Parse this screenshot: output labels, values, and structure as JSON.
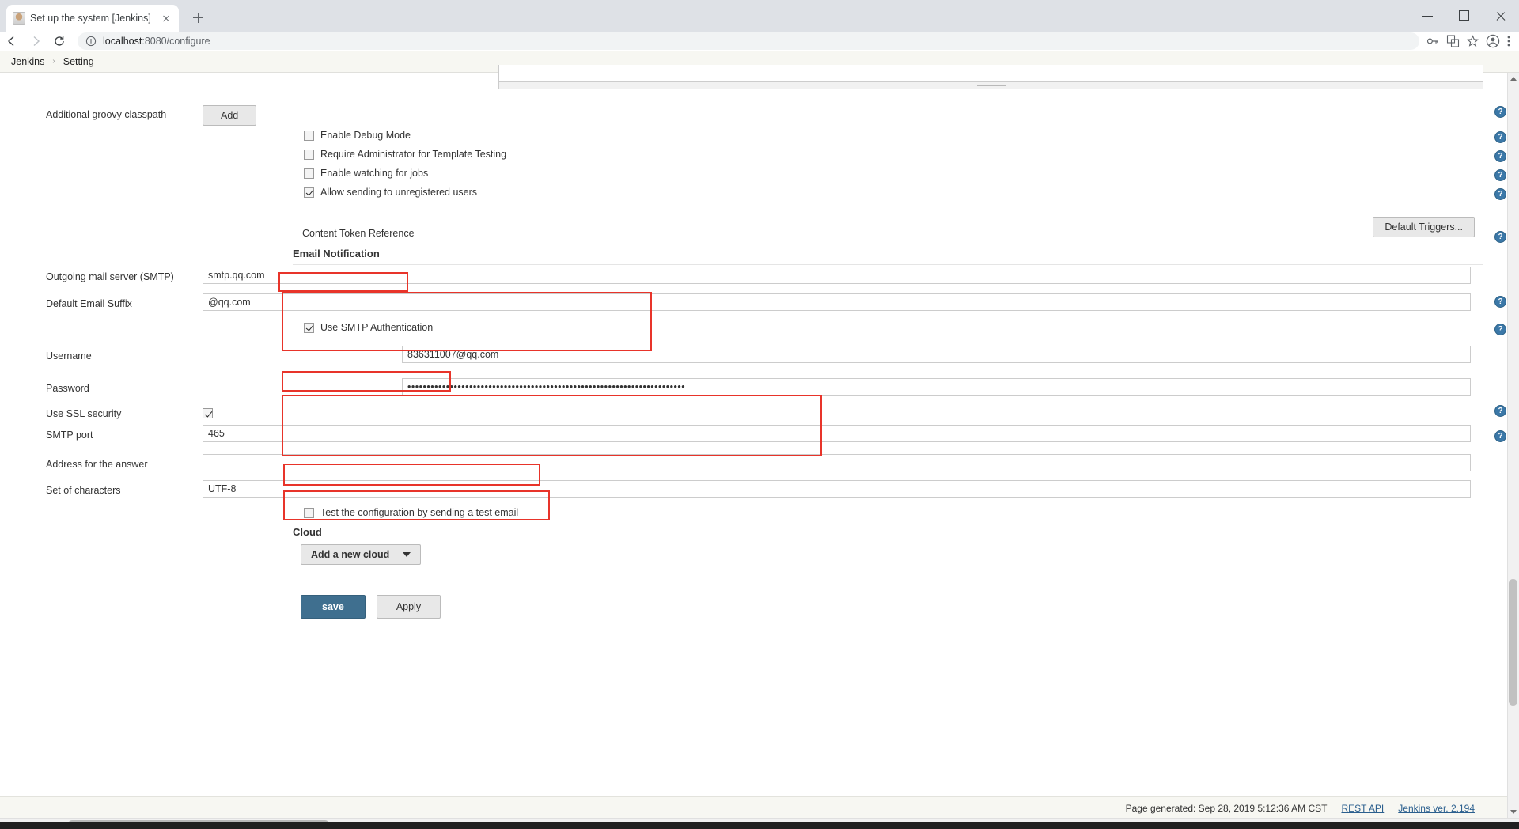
{
  "browser": {
    "tab_title": "Set up the system [Jenkins]",
    "favicon_name": "jenkins-favicon",
    "new_tab_label": "+",
    "url_host": "localhost",
    "url_rest": ":8080/configure",
    "url_full": "localhost:8080/configure",
    "window_minimize": "minimize",
    "window_maximize": "maximize",
    "window_close": "close"
  },
  "breadcrumb": {
    "items": [
      "Jenkins",
      "Setting"
    ],
    "separator": "›"
  },
  "form": {
    "groovy_classpath_label": "Additional groovy classpath",
    "add_button": "Add",
    "checkboxes": [
      {
        "label": "Enable Debug Mode",
        "checked": false
      },
      {
        "label": "Require Administrator for Template Testing",
        "checked": false
      },
      {
        "label": "Enable watching for jobs",
        "checked": false
      },
      {
        "label": "Allow sending to unregistered users",
        "checked": true
      }
    ],
    "default_triggers_button": "Default Triggers...",
    "content_token_reference": "Content Token Reference"
  },
  "email_notification": {
    "section_title": "Email Notification",
    "smtp_server_label": "Outgoing mail server (SMTP)",
    "smtp_server_value": "smtp.qq.com",
    "default_suffix_label": "Default Email Suffix",
    "default_suffix_value": "@qq.com",
    "use_smtp_auth_label": "Use SMTP Authentication",
    "use_smtp_auth_checked": true,
    "username_label": "Username",
    "username_value": "836311007@qq.com",
    "password_label": "Password",
    "password_value": "••••••••••••••••••••••••••••••••••••••••••••••••••••••••••••••••••••••••",
    "use_ssl_label": "Use SSL security",
    "use_ssl_checked": true,
    "smtp_port_label": "SMTP port",
    "smtp_port_value": "465",
    "reply_address_label": "Address for the answer",
    "reply_address_value": "",
    "charset_label": "Set of characters",
    "charset_value": "UTF-8",
    "test_email_label": "Test the configuration by sending a test email",
    "test_email_checked": false
  },
  "cloud": {
    "section_title": "Cloud",
    "add_cloud_button": "Add a new cloud",
    "dropdown_icon": "chevron-down-icon"
  },
  "actions": {
    "save_label": "save",
    "apply_label": "Apply"
  },
  "footer": {
    "page_generated": "Page generated: Sep 28, 2019 5:12:36 AM CST",
    "rest_api": "REST API",
    "version": "Jenkins ver. 2.194"
  },
  "help_icon_label": "?",
  "colors": {
    "highlight": "#e8342a",
    "save_button": "#3f6f8f",
    "help_icon": "#3b78a8",
    "breadcrumb_bg": "#f7f7f2"
  }
}
